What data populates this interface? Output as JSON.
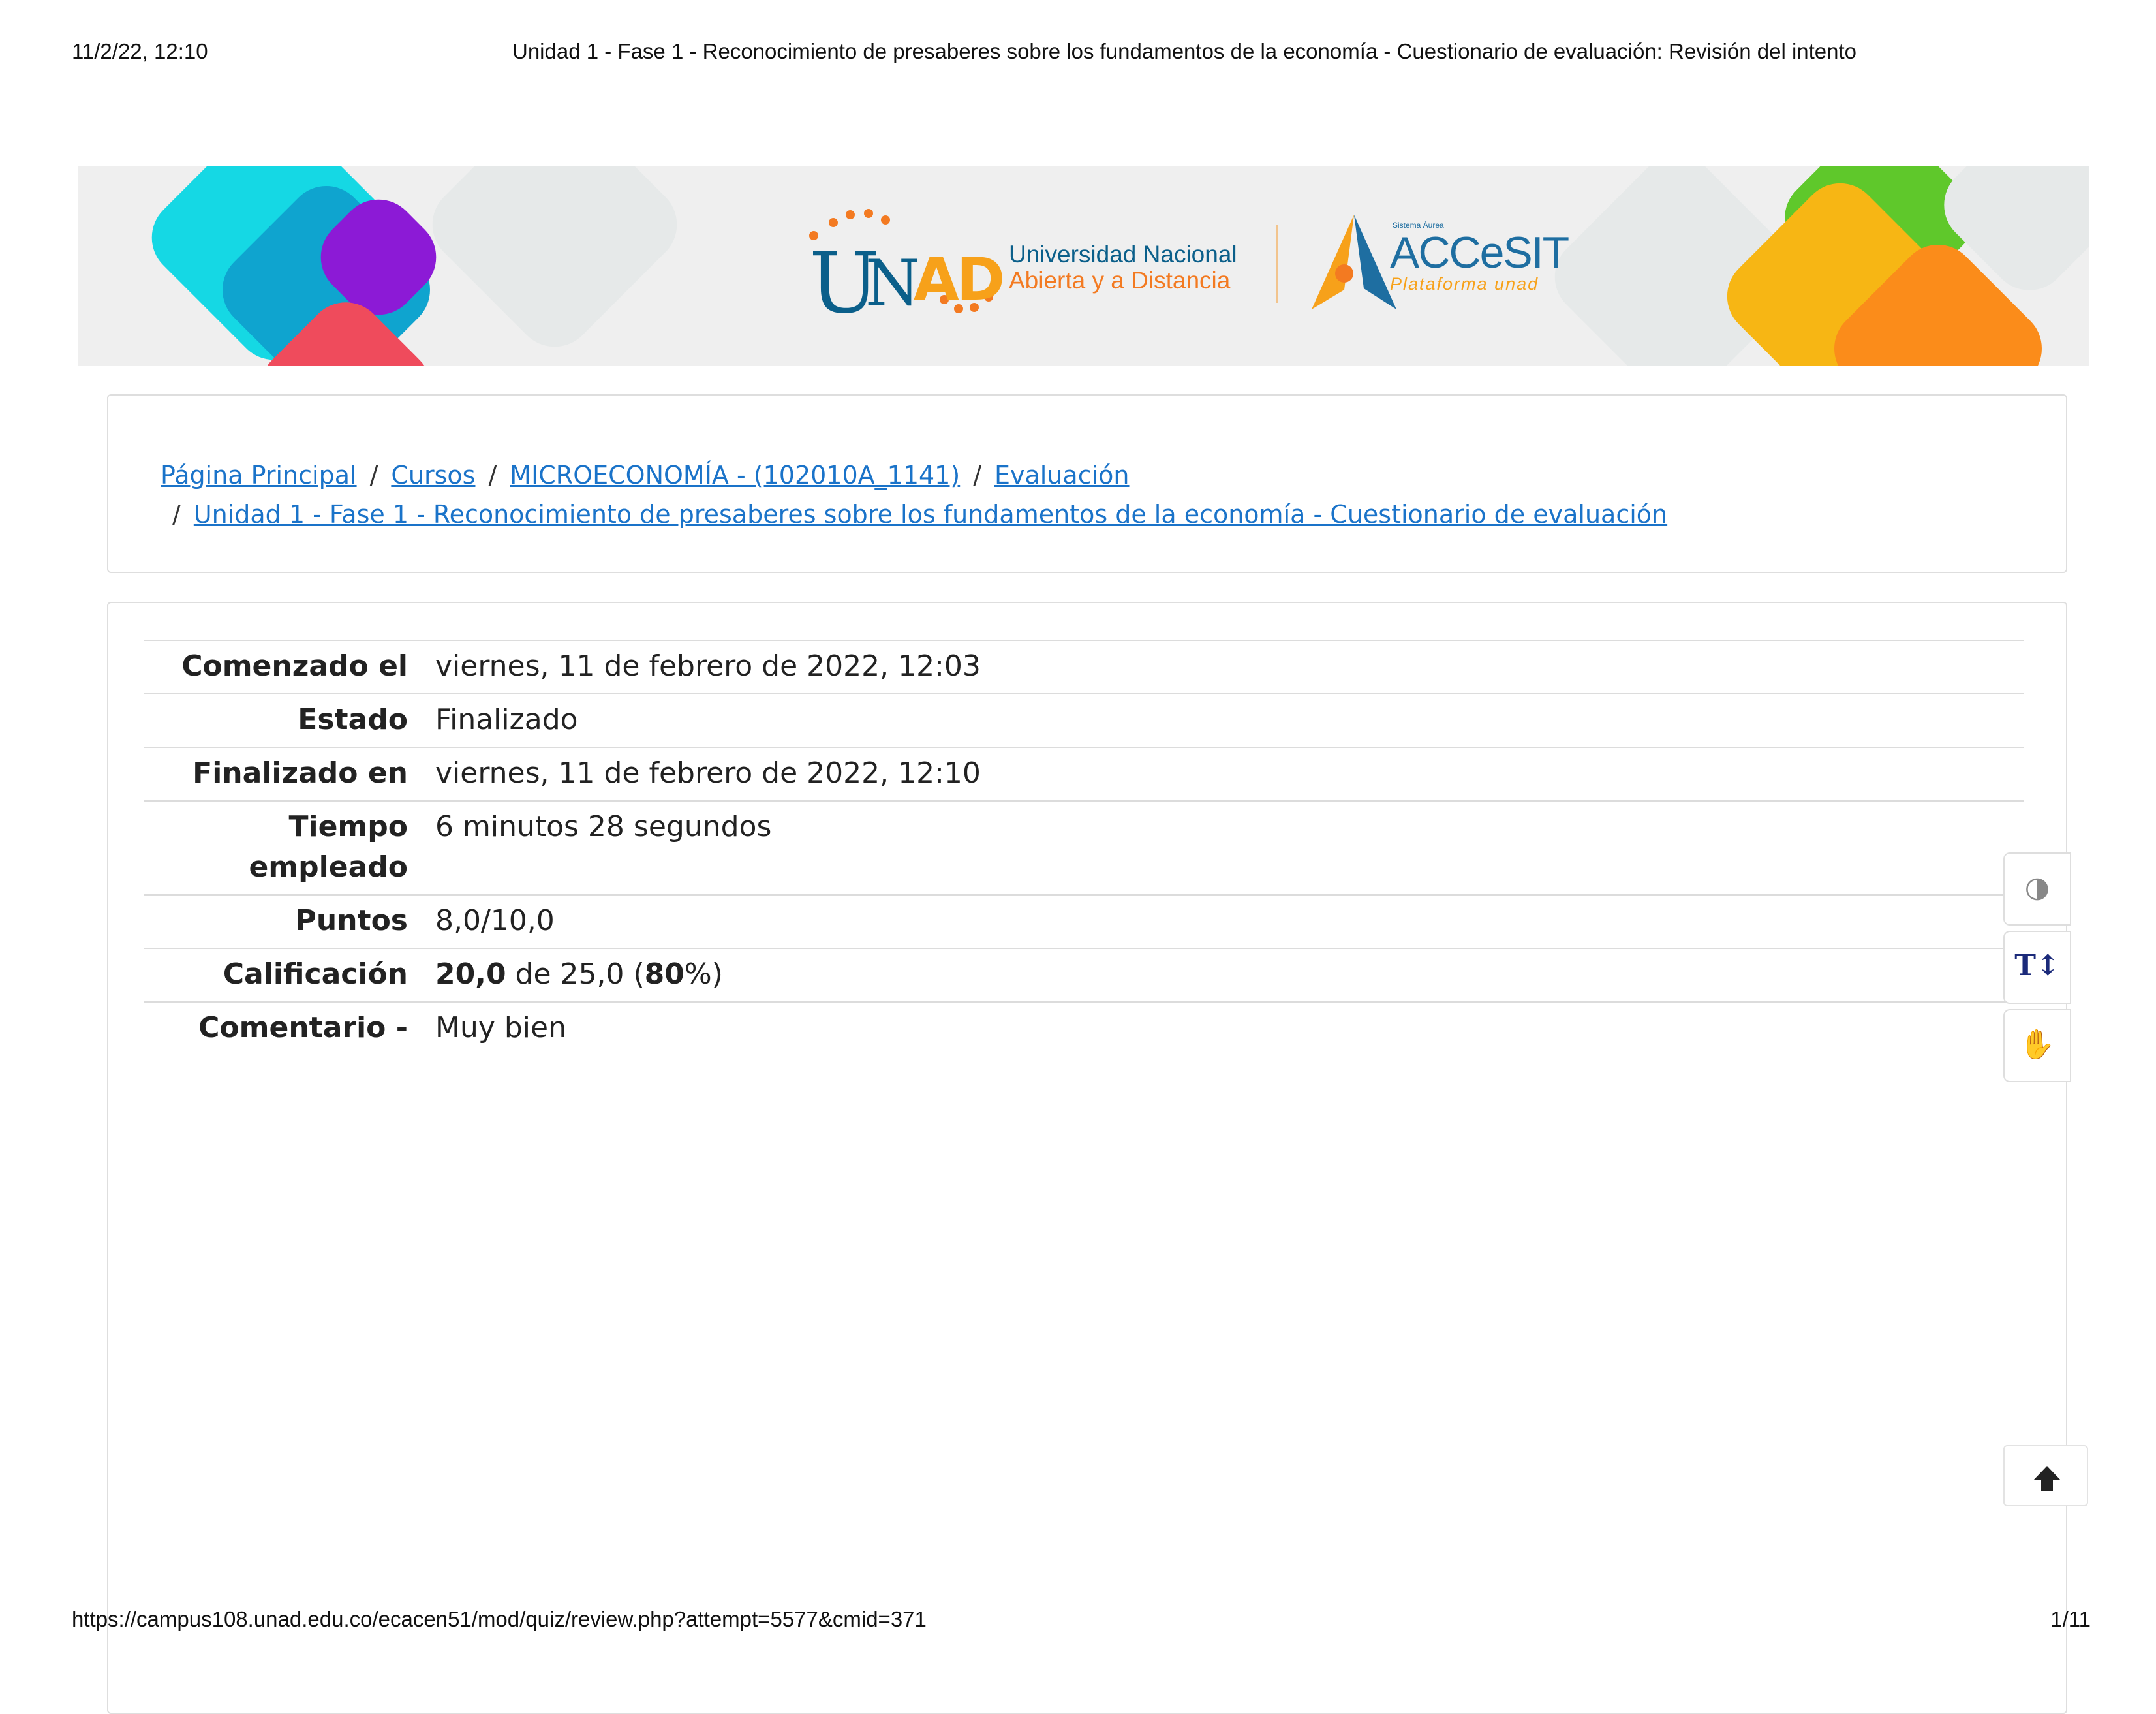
{
  "print_header": {
    "date": "11/2/22, 12:10",
    "title": "Unidad 1 - Fase 1 - Reconocimiento de presaberes sobre los fundamentos de la economía - Cuestionario de evaluación: Revisión del intento"
  },
  "banner": {
    "logo_left": "UNAD",
    "logo_u": "U",
    "logo_n": "N",
    "logo_ad": "AD",
    "university_line1": "Universidad Nacional",
    "university_line2": "Abierta y a Distancia",
    "accesit_title": "ACCeSIT",
    "accesit_subtitle": "Plataforma unad",
    "accesit_tagline": "Sistema Áurea",
    "colors": {
      "unad_blue": "#0b5f8a",
      "unad_orange": "#f37a21",
      "unad_yellow": "#f7a11a"
    }
  },
  "breadcrumb": {
    "items": [
      {
        "label": "Página Principal"
      },
      {
        "label": "Cursos"
      },
      {
        "label": "MICROECONOMÍA - (102010A_1141)"
      },
      {
        "label": "Evaluación"
      },
      {
        "label": "Unidad 1 - Fase 1 - Reconocimiento de presaberes sobre los fundamentos de la economía - Cuestionario de evaluación"
      }
    ],
    "separator": "/",
    "link_color": "#1a73c9"
  },
  "summary": {
    "rows": [
      {
        "label": "Comenzado el",
        "value": "viernes, 11 de febrero de 2022, 12:03"
      },
      {
        "label": "Estado",
        "value": "Finalizado"
      },
      {
        "label": "Finalizado en",
        "value": "viernes, 11 de febrero de 2022, 12:10"
      },
      {
        "label": "Tiempo empleado",
        "value": "6 minutos 28 segundos"
      },
      {
        "label": "Puntos",
        "value": "8,0/10,0"
      },
      {
        "label": "Calificación",
        "value_bold": "20,0",
        "value_mid": " de 25,0 (",
        "value_pct": "80",
        "value_end": "%)"
      },
      {
        "label": "Comentario -",
        "value": "Muy bien"
      }
    ]
  },
  "accessibility_tools": [
    {
      "icon": "contrast-icon",
      "glyph": "◑"
    },
    {
      "icon": "text-size-icon",
      "glyph": "T↕"
    },
    {
      "icon": "sign-language-icon",
      "glyph": "✋"
    }
  ],
  "back_to_top": {
    "icon": "arrow-up-icon"
  },
  "print_footer": {
    "url": "https://campus108.unad.edu.co/ecacen51/mod/quiz/review.php?attempt=5577&cmid=371",
    "page": "1/11"
  }
}
